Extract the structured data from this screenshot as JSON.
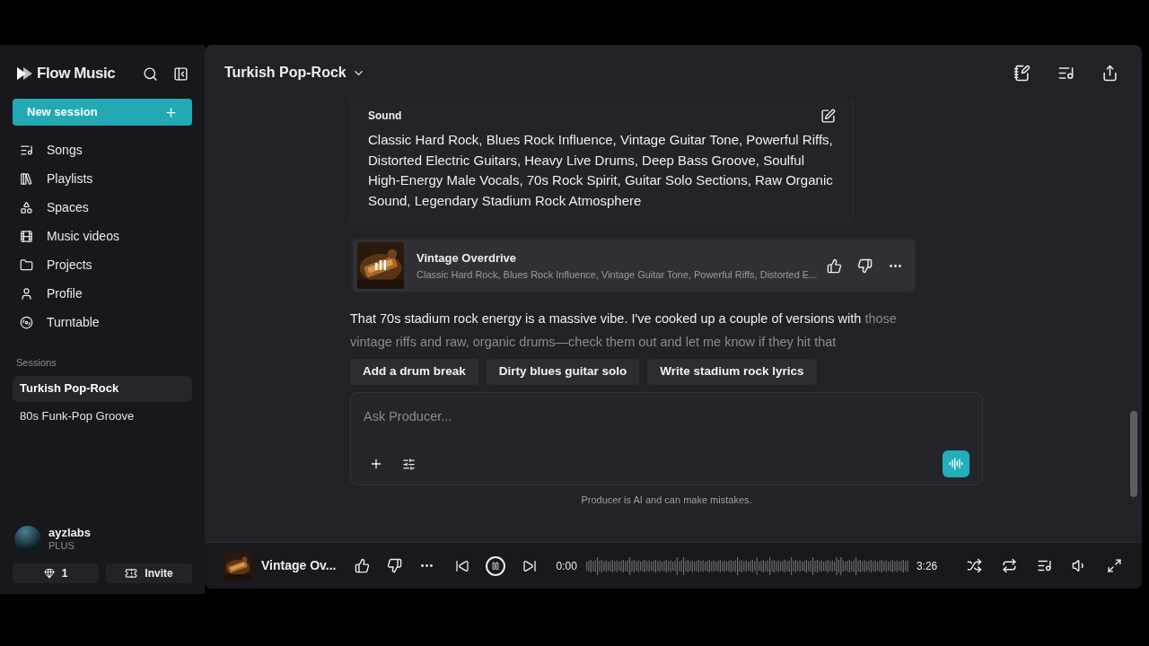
{
  "sidebar": {
    "brand": "Flow Music",
    "new_session": "New session",
    "nav": [
      {
        "kind": "songs",
        "label": "Songs"
      },
      {
        "kind": "playlists",
        "label": "Playlists"
      },
      {
        "kind": "spaces",
        "label": "Spaces"
      },
      {
        "kind": "videos",
        "label": "Music videos"
      },
      {
        "kind": "projects",
        "label": "Projects"
      },
      {
        "kind": "profile",
        "label": "Profile"
      },
      {
        "kind": "turntable",
        "label": "Turntable"
      }
    ],
    "sessions_label": "Sessions",
    "sessions": [
      {
        "label": "Turkish Pop-Rock",
        "selected": true
      },
      {
        "label": "80s Funk-Pop Groove",
        "selected": false
      }
    ],
    "user": {
      "name": "ayzlabs",
      "plan": "PLUS"
    },
    "credits": "1",
    "invite": "Invite"
  },
  "header": {
    "title": "Turkish Pop-Rock"
  },
  "sound_card": {
    "heading": "Sound",
    "text": "Classic Hard Rock, Blues Rock Influence, Vintage Guitar Tone, Powerful Riffs, Distorted Electric Guitars, Heavy Live Drums, Deep Bass Groove, Soulful High-Energy Male Vocals, 70s Rock Spirit, Guitar Solo Sections, Raw Organic Sound, Legendary Stadium Rock Atmosphere"
  },
  "track": {
    "title": "Vintage Overdrive",
    "description": "Classic Hard Rock, Blues Rock Influence, Vintage Guitar Tone, Powerful Riffs, Distorted E...",
    "playing": true
  },
  "message": {
    "text": "That 70s stadium rock energy is a massive vibe. I've cooked up a couple of versions with",
    "faded_text": "those vintage riffs and raw, organic drums—check them out and let me know if they hit that"
  },
  "chips": [
    "Add a drum break",
    "Dirty blues guitar solo",
    "Write stadium rock lyrics"
  ],
  "composer": {
    "placeholder": "Ask Producer..."
  },
  "disclaimer": "Producer is AI and can make mistakes.",
  "player": {
    "title": "Vintage Ov...",
    "current": "0:00",
    "duration": "3:26",
    "playing": true
  }
}
